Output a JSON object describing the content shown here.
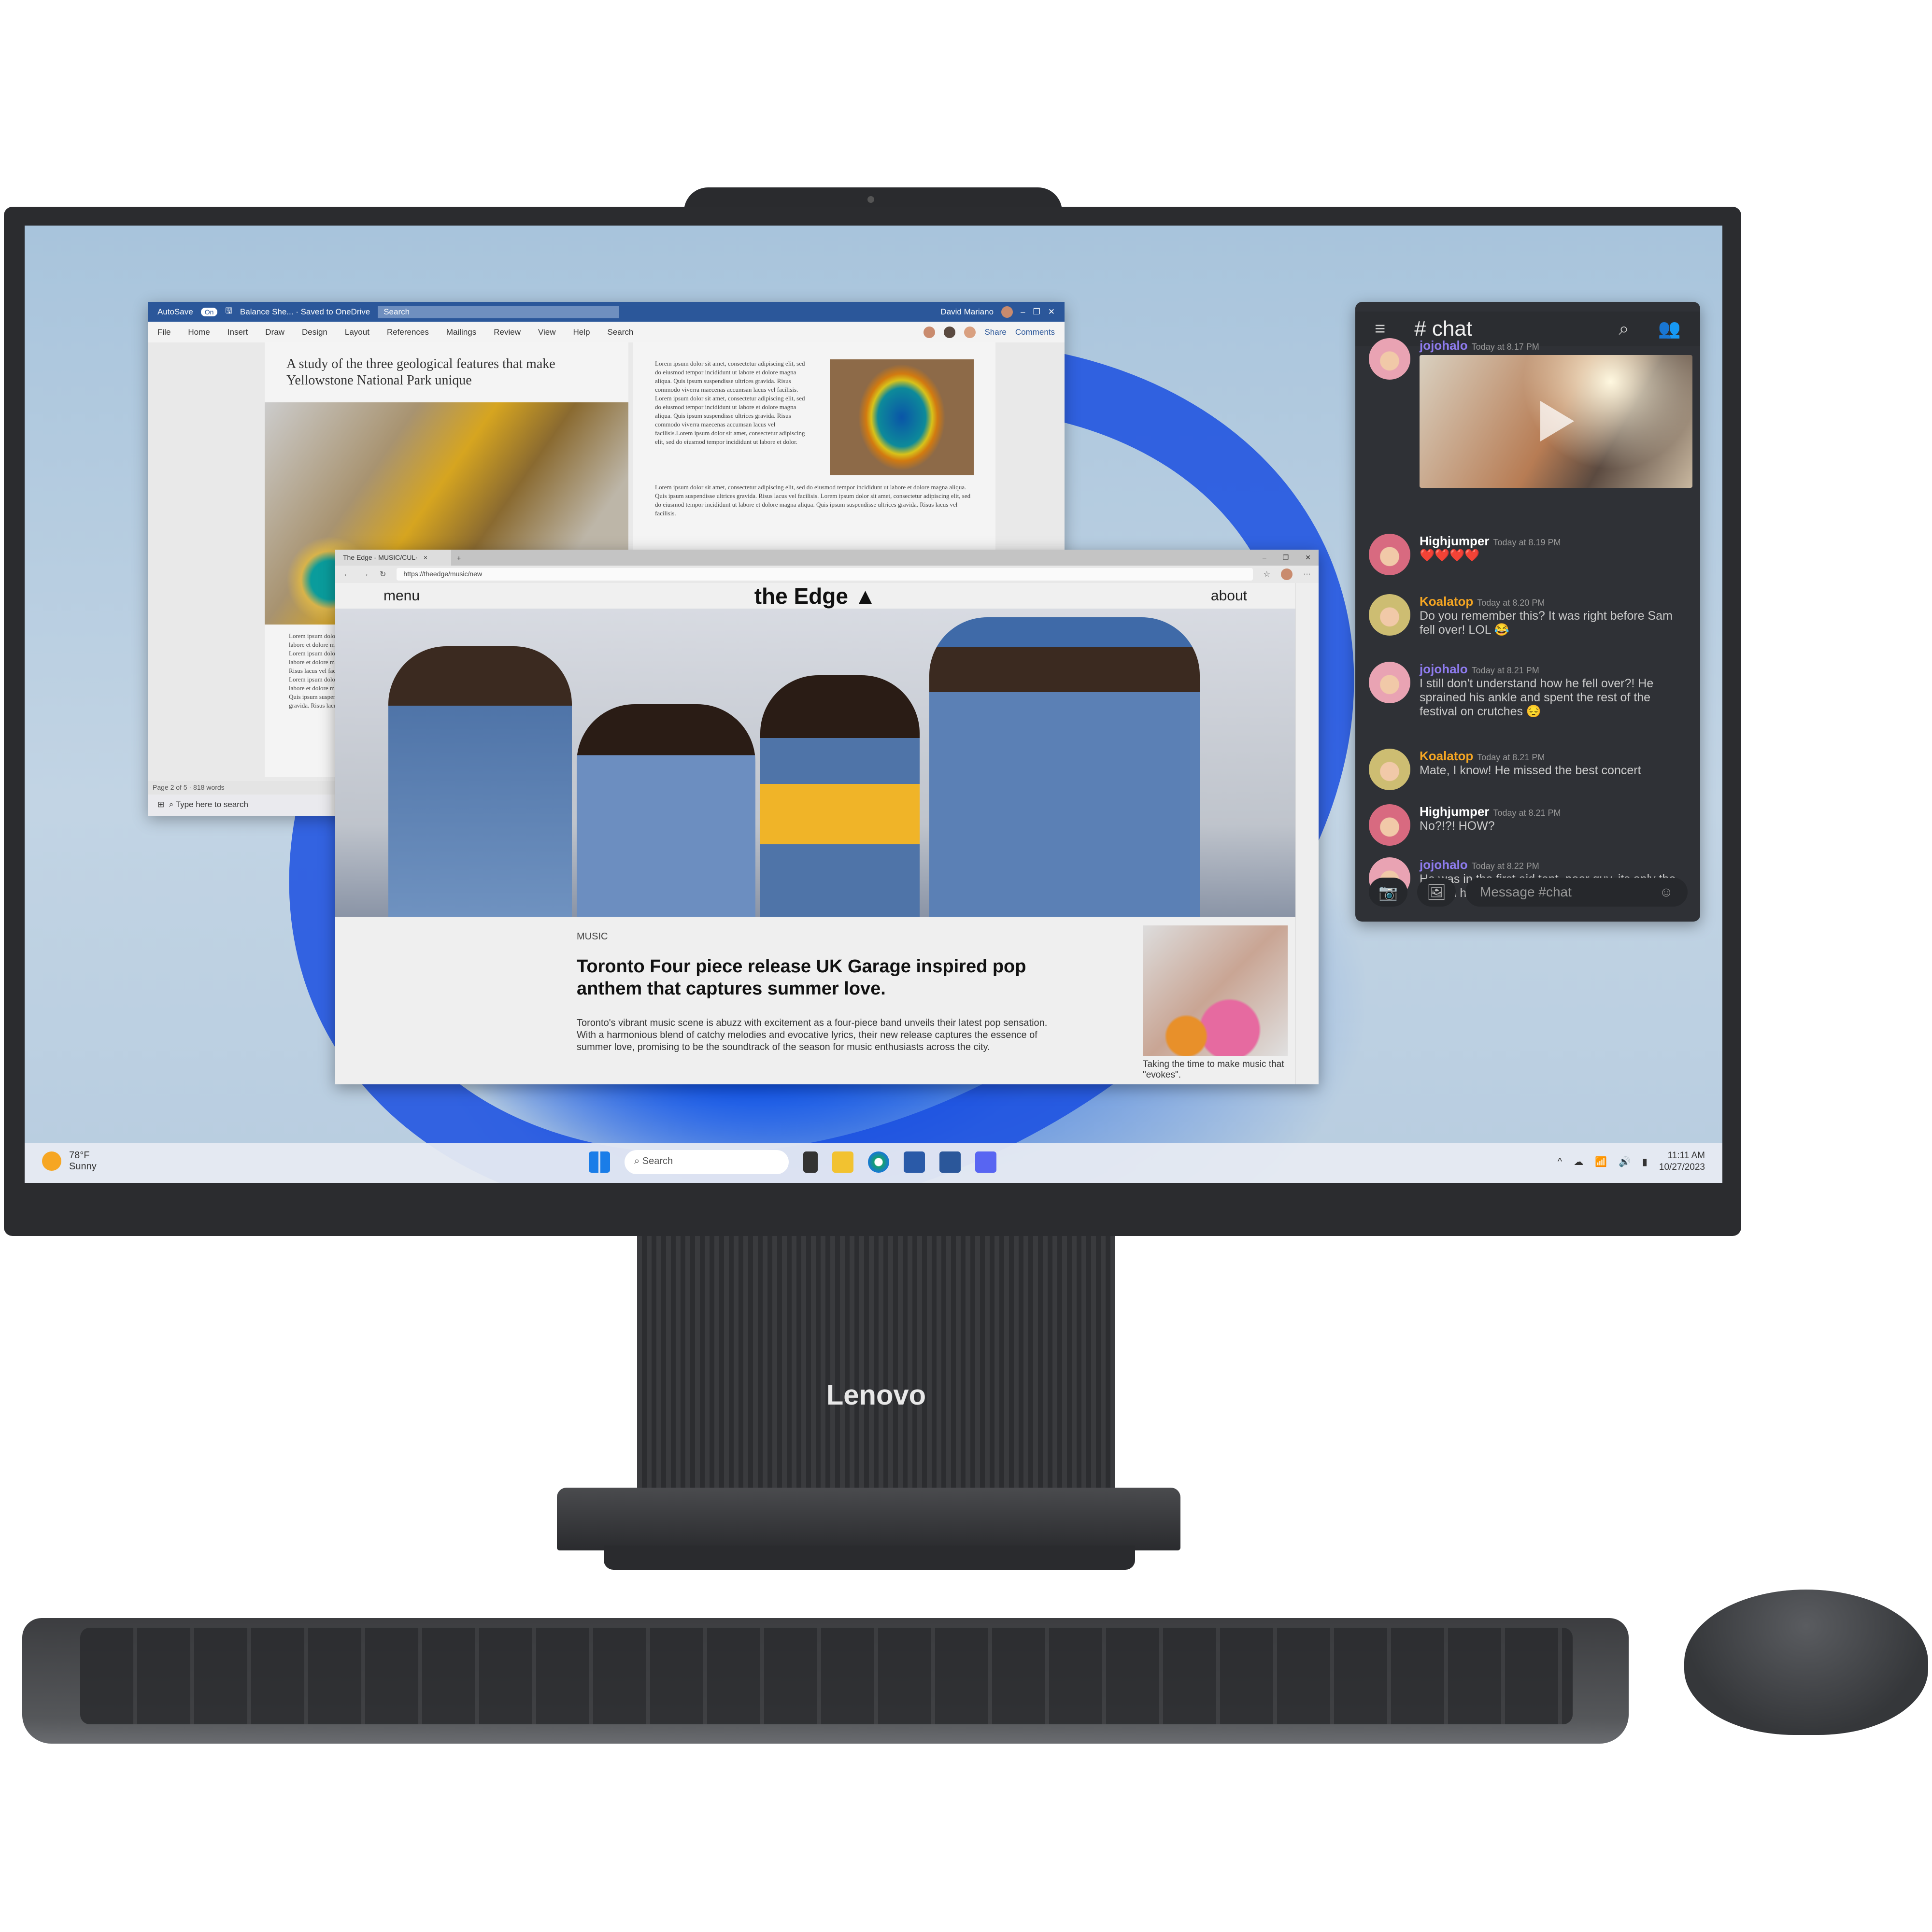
{
  "device": {
    "brand": "Lenovo"
  },
  "word": {
    "autosave": "AutoSave",
    "autosave_state": "On",
    "doc_name": "Balance She... · Saved to OneDrive",
    "search": "Search",
    "user": "David Mariano",
    "ribbon": [
      "File",
      "Home",
      "Insert",
      "Draw",
      "Design",
      "Layout",
      "References",
      "Mailings",
      "Review",
      "View",
      "Help"
    ],
    "ribbon_search": "Search",
    "share": "Share",
    "comments": "Comments",
    "doc_title": "A study of the three geological features that make Yellowstone National Park unique",
    "lorem_column": "Lorem ipsum dolor sit amet, consectetur adipiscing elit, sed do eiusmod tempor incididunt ut labore et dolore magna aliqua. Quis ipsum suspendisse ultrices gravida. Risus commodo viverra maecenas accumsan lacus vel facilisis. Lorem ipsum dolor sit amet, consectetur adipiscing elit, sed do eiusmod tempor incididunt ut labore et dolore magna aliqua. Quis ipsum suspendisse ultrices gravida. Risus commodo viverra maecenas accumsan lacus vel facilisis.Lorem ipsum dolor sit amet, consectetur adipiscing elit, sed do eiusmod tempor incididunt ut labore et dolor.",
    "lorem_wide": "Lorem ipsum dolor sit amet, consectetur adipiscing elit, sed do eiusmod tempor incididunt ut labore et dolore magna aliqua. Quis ipsum suspendisse ultrices gravida. Risus lacus vel facilisis. Lorem ipsum dolor sit amet, consectetur adipiscing elit, sed do eiusmod tempor incididunt ut labore et dolore magna aliqua. Quis ipsum suspendisse ultrices gravida. Risus lacus vel facilisis.",
    "lorem_left": "Lorem ipsum dolor sit amet, labore et dolore magna aliqua. Lorem ipsum dolor sit amet, labore et dolore magna aliqua. Risus lacus vel facilisis. Lorem ipsum dolor sit amet, labore et dolore magna aliqua. Quis ipsum suspendisse gravida. Risus lacus vel.",
    "status": "Page 2 of 5 · 818 words",
    "taskbar_search": "Type here to search"
  },
  "browser": {
    "tab": "The Edge - MUSIC/CUL·",
    "url": "https://theedge/music/new",
    "nav_menu": "menu",
    "logo": "the Edge ▲",
    "nav_about": "about",
    "kicker": "MUSIC",
    "headline": "Toronto Four piece release UK Garage inspired pop anthem that captures summer love.",
    "body": "Toronto's vibrant music scene is abuzz with excitement as a four-piece band unveils their latest pop sensation. With a harmonious blend of catchy melodies and evocative lyrics, their new release captures the essence of summer love, promising to be the soundtrack of the season for music enthusiasts across the city.",
    "caption": "Taking the time to make music that \"evokes\"."
  },
  "chat": {
    "title": "# chat",
    "input_placeholder": "Message #chat",
    "messages": [
      {
        "user": "jojohalo",
        "time": "Today at 8.17 PM",
        "text": "",
        "video": true,
        "color": "#8f7cf0"
      },
      {
        "user": "Highjumper",
        "time": "Today at 8.19 PM",
        "text": "❤️❤️❤️❤️",
        "color": "#ffffff"
      },
      {
        "user": "Koalatop",
        "time": "Today at 8.20 PM",
        "text": "Do you remember this? It was right before Sam fell over! LOL 😂",
        "color": "#f5a623"
      },
      {
        "user": "jojohalo",
        "time": "Today at 8.21 PM",
        "text": "I still don't understand how he fell over?! He sprained his ankle and spent the rest of the festival on crutches 😔",
        "color": "#8f7cf0"
      },
      {
        "user": "Koalatop",
        "time": "Today at 8.21 PM",
        "text": "Mate, I know! He missed the  best  concert",
        "color": "#f5a623"
      },
      {
        "user": "Highjumper",
        "time": "Today at 8.21 PM",
        "text": "No?!?! HOW?",
        "color": "#ffffff"
      },
      {
        "user": "jojohalo",
        "time": "Today at 8.22 PM",
        "text": "He was in the first aid tent, poor guy, its only the reason he bought the tickets 😔",
        "color": "#8f7cf0"
      }
    ]
  },
  "taskbar": {
    "temp": "78°F",
    "weather": "Sunny",
    "search": "Search",
    "time": "11:11 AM",
    "date": "10/27/2023"
  }
}
